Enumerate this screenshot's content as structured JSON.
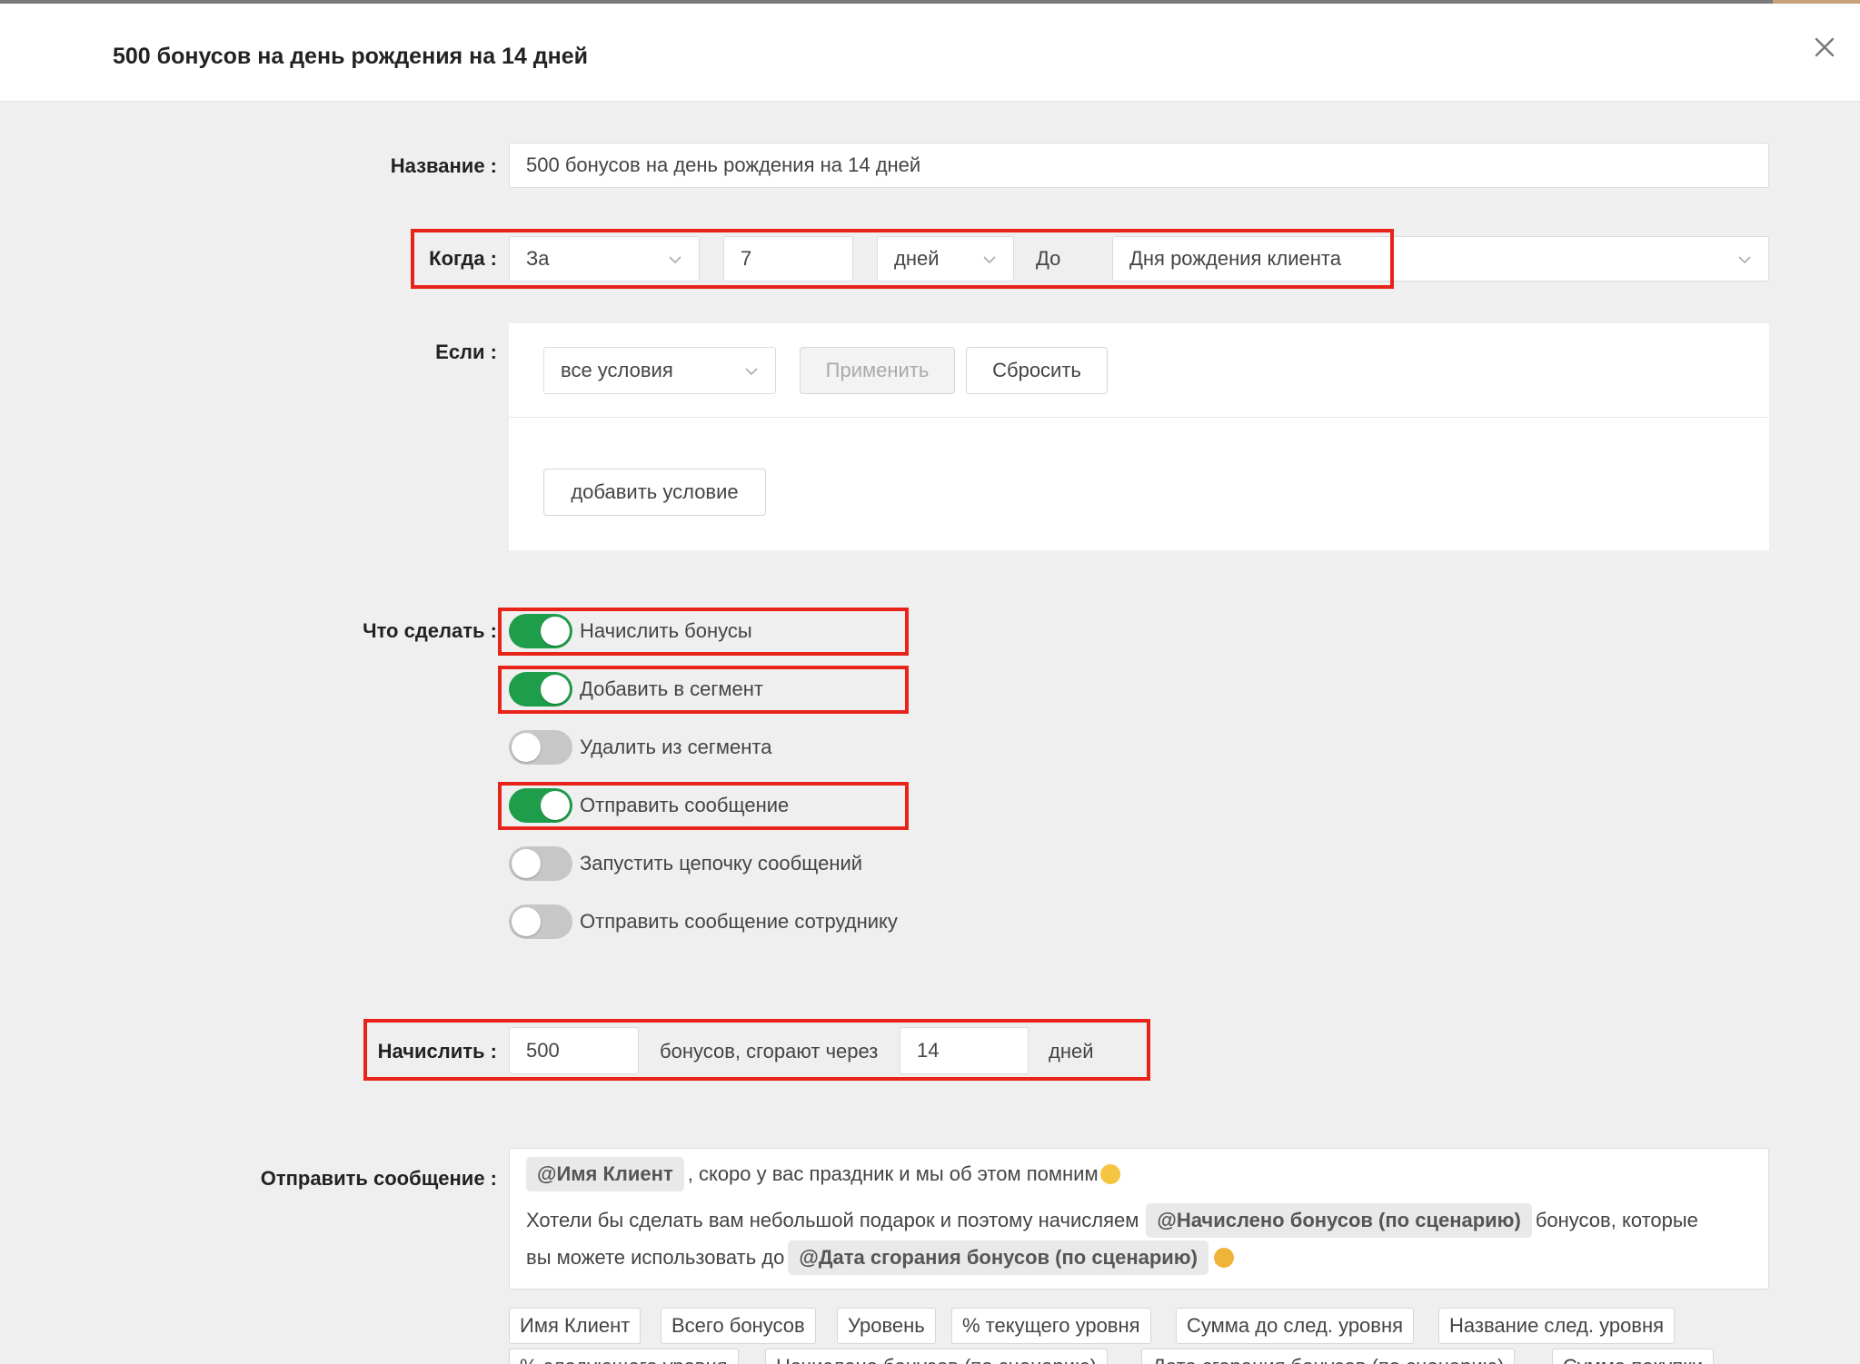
{
  "modal": {
    "title": "500 бонусов на день рождения на 14 дней"
  },
  "form": {
    "name_label": "Название :",
    "name_value": "500 бонусов на день рождения на 14 дней",
    "when_label": "Когда :",
    "when_direction": "За",
    "when_amount": "7",
    "when_unit": "дней",
    "when_relation": "До",
    "when_event": "Дня рождения клиента",
    "if_label": "Если :",
    "if_mode": "все условия",
    "apply_label": "Применить",
    "reset_label": "Сбросить",
    "add_condition_label": "добавить условие",
    "actions_label": "Что сделать :",
    "actions": [
      {
        "label": "Начислить бонусы",
        "on": true
      },
      {
        "label": "Добавить в сегмент",
        "on": true
      },
      {
        "label": "Удалить из сегмента",
        "on": false
      },
      {
        "label": "Отправить сообщение",
        "on": true
      },
      {
        "label": "Запустить цепочку сообщений",
        "on": false
      },
      {
        "label": "Отправить сообщение сотруднику",
        "on": false
      }
    ],
    "accrue_label": "Начислить :",
    "accrue_amount": "500",
    "accrue_middle": "бонусов, сгорают через",
    "accrue_days": "14",
    "accrue_days_unit": "дней",
    "message_label": "Отправить сообщение :",
    "message": {
      "line1_tag": "@Имя Клиент",
      "line1_text": ", скоро у вас праздник и мы об этом помним",
      "line2_text": "Хотели бы сделать вам небольшой подарок и поэтому начисляем",
      "line2_tag": "@Начислено бонусов (по сценарию)",
      "line2_tail": "бонусов, которые",
      "line3_text": "вы можете использовать до",
      "line3_tag": "@Дата сгорания бонусов (по сценарию)"
    },
    "variables": [
      "Имя Клиент",
      "Всего бонусов",
      "Уровень",
      "% текущего уровня",
      "Сумма до след. уровня",
      "Название след. уровня",
      "% следующего уровня",
      "Начислено бонусов (по сценарию)",
      "Дата сгорания бонусов (по сценарию)",
      "Сумма покупки"
    ]
  },
  "colors": {
    "toggle_on": "#1e9e4b",
    "toggle_off": "#c7c7c7",
    "highlight_box": "#e8231a"
  }
}
